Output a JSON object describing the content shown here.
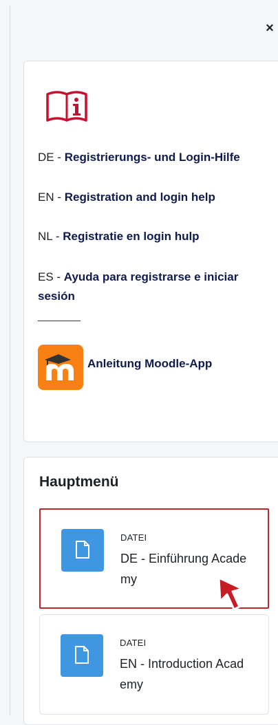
{
  "drawer": {
    "close_label": "×"
  },
  "help_block": {
    "items": [
      {
        "lang": "DE - ",
        "link": "Registrierungs- und Login-Hilfe"
      },
      {
        "lang": "EN - ",
        "link": "Registration and login help"
      },
      {
        "lang": "NL - ",
        "link": "Registratie en login hulp"
      },
      {
        "lang": "ES - ",
        "link": "Ayuda para registrarse e iniciar sesión"
      }
    ],
    "app_link": "Anleitung Moodle-App",
    "app_icon": "moodle-app-icon",
    "info_icon": "info-book-icon"
  },
  "main_menu": {
    "title": "Hauptmenü",
    "activities": [
      {
        "type": "DATEI",
        "name": "DE - Einführung Academy",
        "icon": "file-icon",
        "highlighted": true
      },
      {
        "type": "DATEI",
        "name": "EN - Introduction Academy",
        "icon": "file-icon",
        "highlighted": false
      }
    ]
  },
  "colors": {
    "accent_link": "#0f1a4e",
    "file_icon_bg": "#3e97e0",
    "highlight_border": "#b8282d",
    "moodle_orange": "#f98012",
    "info_red": "#c8102e"
  }
}
